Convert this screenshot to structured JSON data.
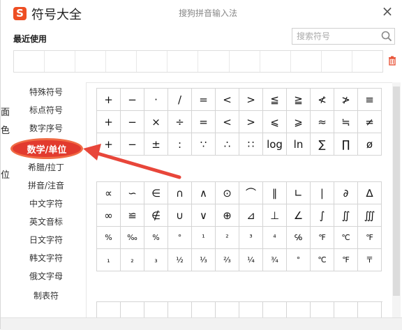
{
  "window": {
    "title": "符号大全",
    "subtitle": "搜狗拼音输入法",
    "logo_letter": "S",
    "close_label": "×"
  },
  "background_fragments": [
    "面",
    "色",
    "位"
  ],
  "recent": {
    "label": "最近使用",
    "slots": 12
  },
  "search": {
    "placeholder": "搜索符号"
  },
  "categories": [
    {
      "label": "特殊符号"
    },
    {
      "label": "标点符号"
    },
    {
      "label": "数字序号"
    },
    {
      "label": "数学/单位",
      "active": true
    },
    {
      "label": "希腊/拉丁"
    },
    {
      "label": "拼音/注音"
    },
    {
      "label": "中文字符"
    },
    {
      "label": "英文音标"
    },
    {
      "label": "日文字符"
    },
    {
      "label": "韩文字符"
    },
    {
      "label": "俄文字母"
    },
    {
      "label": "制表符"
    }
  ],
  "grid1": [
    [
      "+",
      "−",
      "·",
      "/",
      "=",
      "<",
      ">",
      "≦",
      "≧",
      "≮",
      "≯",
      "≡"
    ],
    [
      "+",
      "−",
      "×",
      "÷",
      "=",
      "<",
      ">",
      "⩽",
      "⩾",
      "≈",
      "≒",
      "≠"
    ],
    [
      "+",
      "−",
      "±",
      ":",
      "∵",
      "∴",
      "∷",
      "log",
      "ln",
      "∑",
      "∏",
      "ø"
    ]
  ],
  "grid2": [
    [
      "∝",
      "∽",
      "∈",
      "∩",
      "∧",
      "⊙",
      "⌒",
      "∥",
      "∟",
      "∣",
      "∂",
      "∆"
    ],
    [
      "∞",
      "≌",
      "∉",
      "∪",
      "∨",
      "⊕",
      "⊿",
      "⊥",
      "∠",
      "∫",
      "∬",
      "∭"
    ],
    [
      "%",
      "‰",
      "%",
      "°",
      "¹",
      "²",
      "³",
      "⁴",
      "℅",
      "℉",
      "℃",
      "℉"
    ],
    [
      "₁",
      "₂",
      "₃",
      "½",
      "⅓",
      "⅔",
      "¼",
      "¾",
      "°",
      "℃",
      "℉",
      "〒"
    ]
  ],
  "colors": {
    "accent": "#e23a2e",
    "logo": "#ee4e23",
    "arrow": "#e8463a"
  }
}
